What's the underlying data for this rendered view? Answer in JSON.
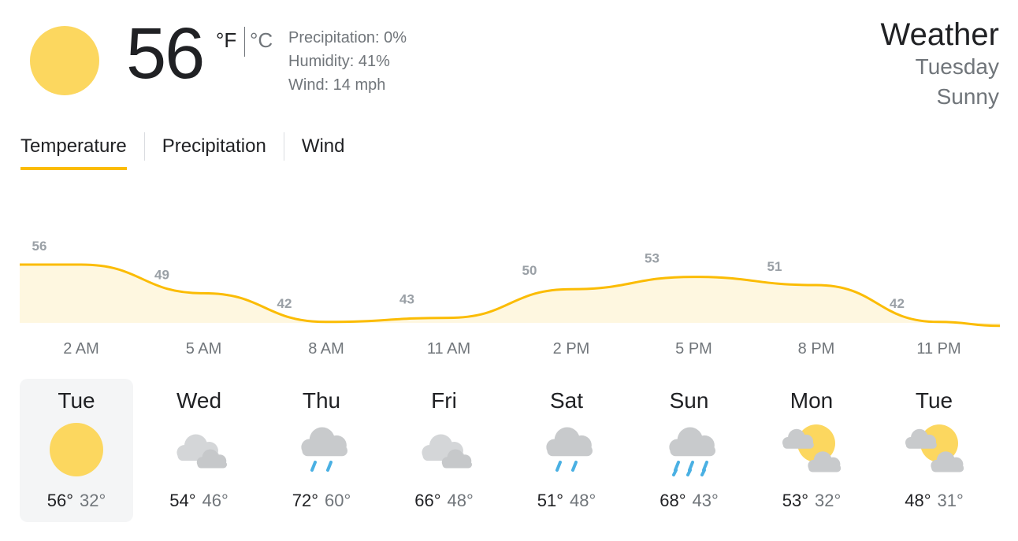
{
  "current": {
    "icon": "sun-icon",
    "temperature": "56",
    "unit_f": "°F",
    "unit_c": "°C",
    "precipitation": "Precipitation: 0%",
    "humidity": "Humidity: 41%",
    "wind": "Wind: 14 mph"
  },
  "header": {
    "title": "Weather",
    "day": "Tuesday",
    "condition": "Sunny"
  },
  "tabs": [
    {
      "label": "Temperature",
      "active": true
    },
    {
      "label": "Precipitation",
      "active": false
    },
    {
      "label": "Wind",
      "active": false
    }
  ],
  "chart_data": {
    "type": "area",
    "categories": [
      "2 AM",
      "5 AM",
      "8 AM",
      "11 AM",
      "2 PM",
      "5 PM",
      "8 PM",
      "11 PM"
    ],
    "values": [
      56,
      49,
      42,
      43,
      50,
      53,
      51,
      42
    ],
    "line_color": "#fbbc04",
    "fill_color": "#fef7e0"
  },
  "days": [
    {
      "name": "Tue",
      "icon": "sun-icon",
      "high": "56°",
      "low": "32°",
      "selected": true
    },
    {
      "name": "Wed",
      "icon": "cloudy-icon",
      "high": "54°",
      "low": "46°"
    },
    {
      "name": "Thu",
      "icon": "showers-icon",
      "high": "72°",
      "low": "60°"
    },
    {
      "name": "Fri",
      "icon": "cloudy-icon",
      "high": "66°",
      "low": "48°"
    },
    {
      "name": "Sat",
      "icon": "showers-icon",
      "high": "51°",
      "low": "48°"
    },
    {
      "name": "Sun",
      "icon": "rain-icon",
      "high": "68°",
      "low": "43°"
    },
    {
      "name": "Mon",
      "icon": "partly-cloudy-icon",
      "high": "53°",
      "low": "32°"
    },
    {
      "name": "Tue",
      "icon": "partly-cloudy-icon",
      "high": "48°",
      "low": "31°"
    }
  ],
  "colors": {
    "sun": "#fcd75f",
    "cloud": "#c8cacc",
    "rain": "#4ab0e3",
    "accent": "#fbbc04"
  }
}
